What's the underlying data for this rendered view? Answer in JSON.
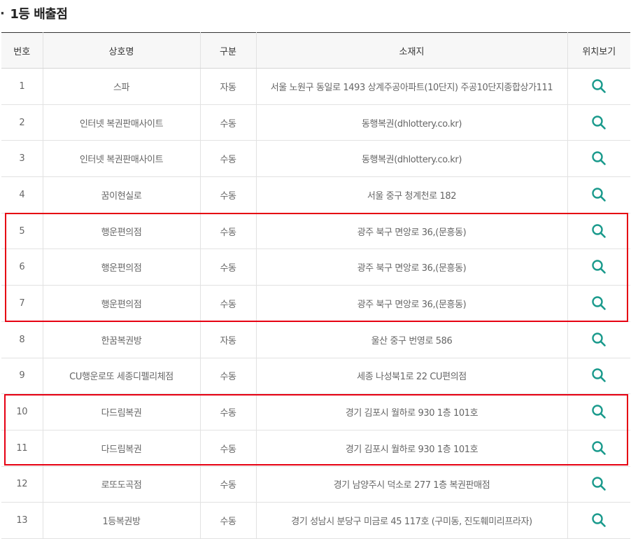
{
  "section": {
    "bullet": "·",
    "title": "1등 배출점"
  },
  "table": {
    "headers": [
      "번호",
      "상호명",
      "구분",
      "소재지",
      "위치보기"
    ],
    "rows": [
      {
        "no": "1",
        "name": "스파",
        "type": "자동",
        "address": "서울 노원구 동일로 1493 상계주공아파트(10단지) 주공10단지종합상가111"
      },
      {
        "no": "2",
        "name": "인터넷 복권판매사이트",
        "type": "수동",
        "address": "동행복권(dhlottery.co.kr)"
      },
      {
        "no": "3",
        "name": "인터넷 복권판매사이트",
        "type": "수동",
        "address": "동행복권(dhlottery.co.kr)"
      },
      {
        "no": "4",
        "name": "꿈이현실로",
        "type": "수동",
        "address": "서울 중구 청계천로 182"
      },
      {
        "no": "5",
        "name": "행운편의점",
        "type": "수동",
        "address": "광주 북구 면앙로 36,(문흥동)"
      },
      {
        "no": "6",
        "name": "행운편의점",
        "type": "수동",
        "address": "광주 북구 면앙로 36,(문흥동)"
      },
      {
        "no": "7",
        "name": "행운편의점",
        "type": "수동",
        "address": "광주 북구 면앙로 36,(문흥동)"
      },
      {
        "no": "8",
        "name": "한꿈복권방",
        "type": "자동",
        "address": "울산 중구 번영로 586"
      },
      {
        "no": "9",
        "name": "CU행운로또 세종디펠리체점",
        "type": "수동",
        "address": "세종 나성북1로 22 CU편의점"
      },
      {
        "no": "10",
        "name": "다드림복권",
        "type": "수동",
        "address": "경기 김포시 월하로 930 1층 101호"
      },
      {
        "no": "11",
        "name": "다드림복권",
        "type": "수동",
        "address": "경기 김포시 월하로 930 1층 101호"
      },
      {
        "no": "12",
        "name": "로또도곡점",
        "type": "수동",
        "address": "경기 남양주시 덕소로 277 1층 복권판매점"
      },
      {
        "no": "13",
        "name": "1등복권방",
        "type": "수동",
        "address": "경기 성남시 분당구 미금로 45 117호 (구미동, 진도훼미리프라자)"
      }
    ],
    "location_icon": "search-icon",
    "icon_color": "#1a9a8c"
  },
  "highlights": {
    "color": "#e60012",
    "groups": [
      [
        "5",
        "6",
        "7"
      ],
      [
        "10",
        "11"
      ]
    ]
  }
}
